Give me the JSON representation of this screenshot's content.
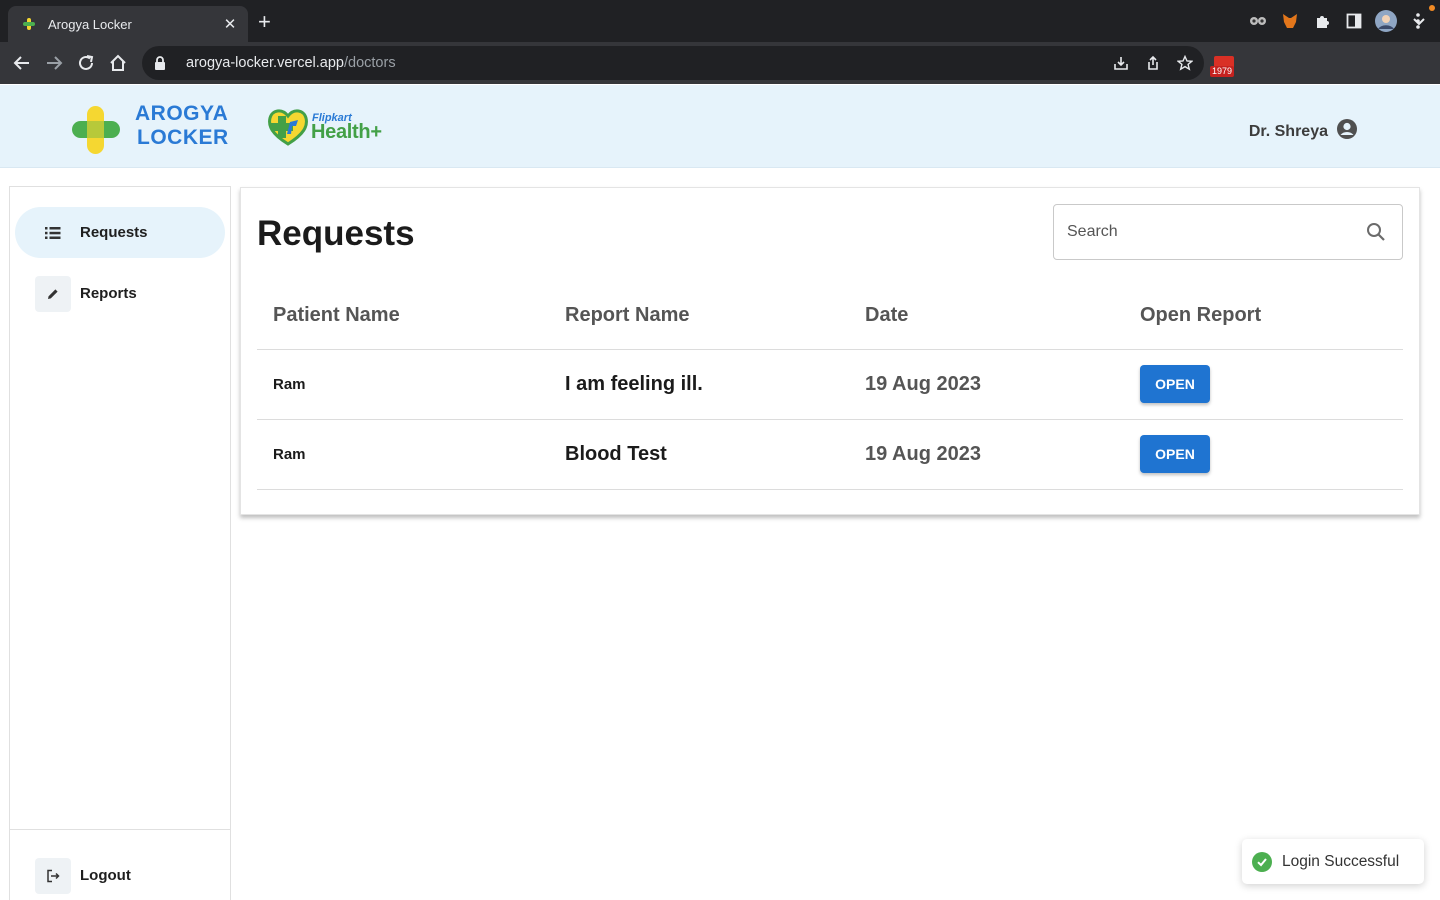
{
  "browser": {
    "tab_title": "Arogya Locker",
    "url_host": "arogya-locker.vercel.app",
    "url_path": "/doctors",
    "extension_badge": "1979"
  },
  "header": {
    "logo_line1": "AROGYA",
    "logo_line2": "LOCKER",
    "partner_small": "Flipkart",
    "partner_big": "Health+",
    "user_name": "Dr. Shreya"
  },
  "sidebar": {
    "items": [
      {
        "label": "Requests",
        "icon": "list-icon",
        "active": true
      },
      {
        "label": "Reports",
        "icon": "pencil-icon",
        "active": false
      }
    ],
    "logout_label": "Logout"
  },
  "main": {
    "title": "Requests",
    "search_placeholder": "Search",
    "columns": [
      "Patient Name",
      "Report Name",
      "Date",
      "Open Report"
    ],
    "rows": [
      {
        "patient": "Ram",
        "report": "I am feeling ill.",
        "date": "19 Aug 2023",
        "action": "OPEN"
      },
      {
        "patient": "Ram",
        "report": "Blood Test",
        "date": "19 Aug 2023",
        "action": "OPEN"
      }
    ]
  },
  "toast": {
    "message": "Login Successful",
    "icon": "check-circle-icon"
  },
  "colors": {
    "accent": "#1f74d1",
    "header_bg": "#e6f3fb",
    "success": "#4caf50"
  }
}
